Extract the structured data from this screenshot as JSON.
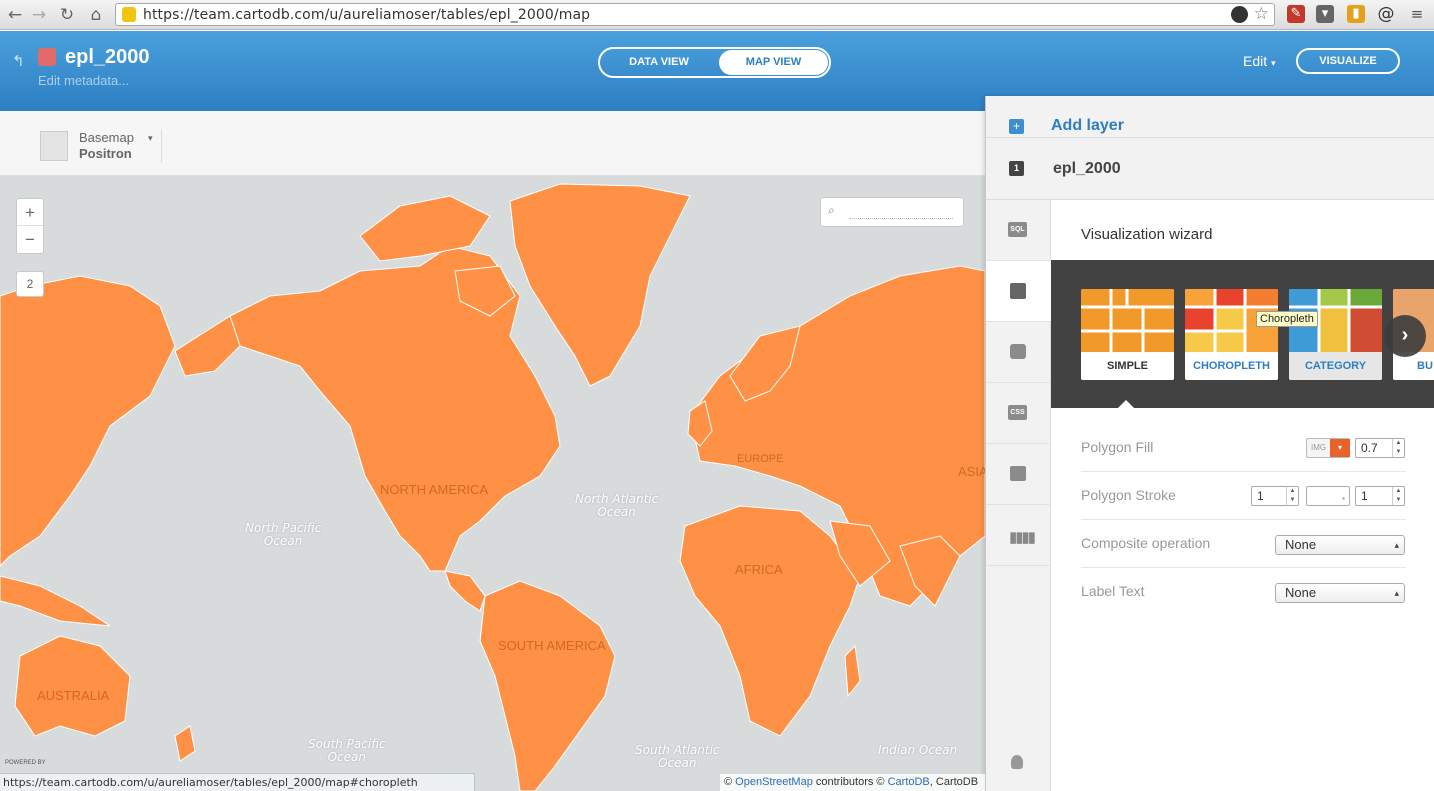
{
  "browser": {
    "url": "https://team.cartodb.com/u/aureliamoser/tables/epl_2000/map"
  },
  "header": {
    "title": "epl_2000",
    "edit_metadata": "Edit metadata...",
    "data_view": "DATA VIEW",
    "map_view": "MAP VIEW",
    "edit": "Edit",
    "visualize": "VISUALIZE"
  },
  "toolbar": {
    "basemap_label": "Basemap",
    "basemap_value": "Positron"
  },
  "map": {
    "zoom_in": "+",
    "zoom_out": "−",
    "zoom_level": "2",
    "land_color": "#ff9147",
    "ocean_color": "#d7dbdc",
    "labels": {
      "north_pacific": "North Pacific\nOcean",
      "north_atlantic": "North Atlantic\nOcean",
      "south_pacific": "South Pacific\nOcean",
      "south_atlantic": "South Atlantic\nOcean",
      "indian": "Indian Ocean",
      "north_america": "NORTH AMERICA",
      "south_america": "SOUTH AMERICA",
      "africa": "AFRICA",
      "europe": "EUROPE",
      "asia": "ASIA",
      "australia": "AUSTRALIA"
    },
    "powered_by": "POWERED BY"
  },
  "panel": {
    "add_layer": "Add layer",
    "layer_number": "1",
    "layer_name": "epl_2000",
    "sidebar": [
      "SQL",
      "wizard",
      "infowindow",
      "CSS",
      "legend",
      "filters"
    ],
    "wizard_title": "Visualization wizard",
    "cards": [
      "SIMPLE",
      "CHOROPLETH",
      "CATEGORY",
      "BU"
    ],
    "tooltip": "Choropleth",
    "polygon_fill_label": "Polygon Fill",
    "polygon_fill_img": "IMG",
    "polygon_fill_opacity": "0.7",
    "polygon_stroke_label": "Polygon Stroke",
    "polygon_stroke_width": "1",
    "polygon_stroke_opacity": "1",
    "composite_label": "Composite operation",
    "composite_value": "None",
    "label_text_label": "Label Text",
    "label_text_value": "None"
  },
  "statusbar": {
    "link": "https://team.cartodb.com/u/aureliamoser/tables/epl_2000/map#choropleth"
  },
  "attribution": {
    "prefix": "©",
    "osm": "OpenStreetMap",
    "middle": "contributors ©",
    "cartodb": "CartoDB",
    "suffix": ", CartoDB"
  }
}
